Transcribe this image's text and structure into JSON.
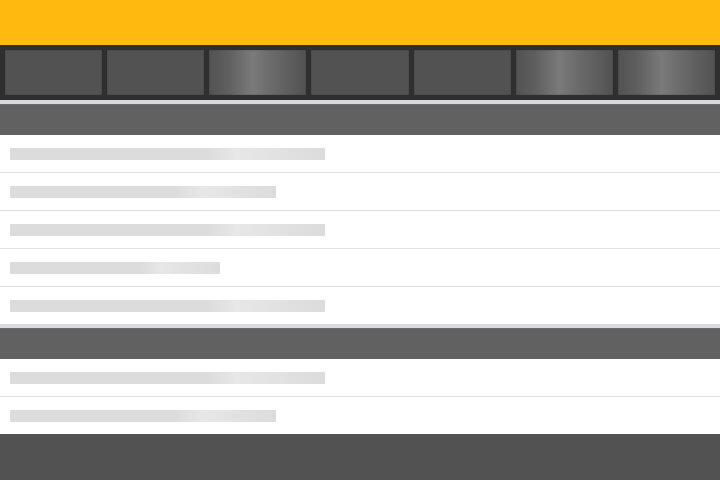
{
  "app": {
    "title": "",
    "brand_color": "#ffb90f",
    "state": "loading-skeleton"
  },
  "tabs": [
    {
      "label": ""
    },
    {
      "label": ""
    },
    {
      "label": ""
    },
    {
      "label": ""
    },
    {
      "label": ""
    },
    {
      "label": ""
    },
    {
      "label": ""
    }
  ],
  "sections": [
    {
      "title": "",
      "rows": [
        {
          "text": ""
        },
        {
          "text": ""
        },
        {
          "text": ""
        },
        {
          "text": ""
        },
        {
          "text": ""
        }
      ]
    },
    {
      "title": "",
      "rows": [
        {
          "text": ""
        },
        {
          "text": ""
        }
      ]
    }
  ],
  "colors": {
    "topbar": "#ffb90f",
    "tabstrip": "#2f2f2f",
    "tab_placeholder": "#525252",
    "section_header": "#616161",
    "separator": "#d7dbe0",
    "row_placeholder": "#dcdcdc",
    "footer": "#525252"
  }
}
